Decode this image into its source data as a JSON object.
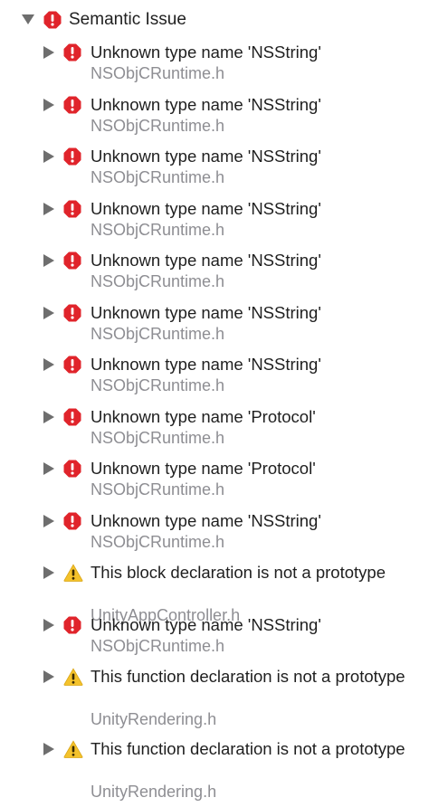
{
  "group": {
    "title": "Semantic Issue",
    "icon": "error-icon"
  },
  "colors": {
    "error": "#e0242b",
    "warning": "#f4c22b",
    "disclosure": "#6e6e6e",
    "file_text": "#8e8e93"
  },
  "issues": [
    {
      "type": "error",
      "title": "Unknown type name 'NSString'",
      "file": "NSObjCRuntime.h"
    },
    {
      "type": "error",
      "title": "Unknown type name 'NSString'",
      "file": "NSObjCRuntime.h"
    },
    {
      "type": "error",
      "title": "Unknown type name 'NSString'",
      "file": "NSObjCRuntime.h"
    },
    {
      "type": "error",
      "title": "Unknown type name 'NSString'",
      "file": "NSObjCRuntime.h"
    },
    {
      "type": "error",
      "title": "Unknown type name 'NSString'",
      "file": "NSObjCRuntime.h"
    },
    {
      "type": "error",
      "title": "Unknown type name 'NSString'",
      "file": "NSObjCRuntime.h"
    },
    {
      "type": "error",
      "title": "Unknown type name 'NSString'",
      "file": "NSObjCRuntime.h"
    },
    {
      "type": "error",
      "title": "Unknown type name 'Protocol'",
      "file": "NSObjCRuntime.h"
    },
    {
      "type": "error",
      "title": "Unknown type name 'Protocol'",
      "file": "NSObjCRuntime.h"
    },
    {
      "type": "error",
      "title": "Unknown type name 'NSString'",
      "file": "NSObjCRuntime.h"
    },
    {
      "type": "warning",
      "title": "This block declaration is not a prototype",
      "file": "UnityAppController.h"
    },
    {
      "type": "error",
      "title": "Unknown type name 'NSString'",
      "file": "NSObjCRuntime.h"
    },
    {
      "type": "warning",
      "title": "This function declaration is not a prototype",
      "file": "UnityRendering.h"
    },
    {
      "type": "warning",
      "title": "This function declaration is not a prototype",
      "file": "UnityRendering.h"
    }
  ]
}
